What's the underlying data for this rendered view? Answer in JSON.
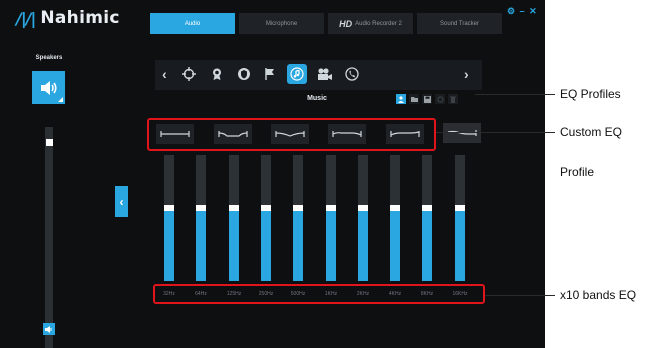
{
  "app": {
    "logo_mark": "/|/|",
    "logo_text": "Nahimic",
    "tabs": [
      {
        "label": "Audio",
        "active": true
      },
      {
        "label": "Microphone",
        "active": false
      },
      {
        "hd": "HD",
        "label": "Audio Recorder 2",
        "active": false
      },
      {
        "label": "Sound Tracker",
        "active": false
      }
    ],
    "window_controls": "⚙ – ✕"
  },
  "left_panel": {
    "speakers_label": "Speakers",
    "volume_level": 0.93
  },
  "scenario": {
    "title": "Music",
    "icons": [
      "crosshair-icon",
      "badge-icon",
      "shield-icon",
      "flag-icon",
      "music-icon",
      "movie-camera-icon",
      "phone-icon"
    ],
    "active_index": 4
  },
  "eq": {
    "bands": [
      {
        "freq": "32Hz",
        "level": 0.58
      },
      {
        "freq": "64Hz",
        "level": 0.58
      },
      {
        "freq": "125Hz",
        "level": 0.58
      },
      {
        "freq": "250Hz",
        "level": 0.58
      },
      {
        "freq": "500Hz",
        "level": 0.58
      },
      {
        "freq": "1KHz",
        "level": 0.58
      },
      {
        "freq": "2KHz",
        "level": 0.58
      },
      {
        "freq": "4KHz",
        "level": 0.58
      },
      {
        "freq": "8KHz",
        "level": 0.58
      },
      {
        "freq": "16KHz",
        "level": 0.58
      }
    ]
  },
  "annotations": {
    "eq_profiles": "EQ Profiles",
    "custom_eq_line1": "Custom EQ",
    "custom_eq_line2": "Profile",
    "bands": "x10 bands EQ"
  },
  "colors": {
    "accent": "#2aa7e0",
    "callout": "#e0141a",
    "background": "#0d0f11"
  }
}
